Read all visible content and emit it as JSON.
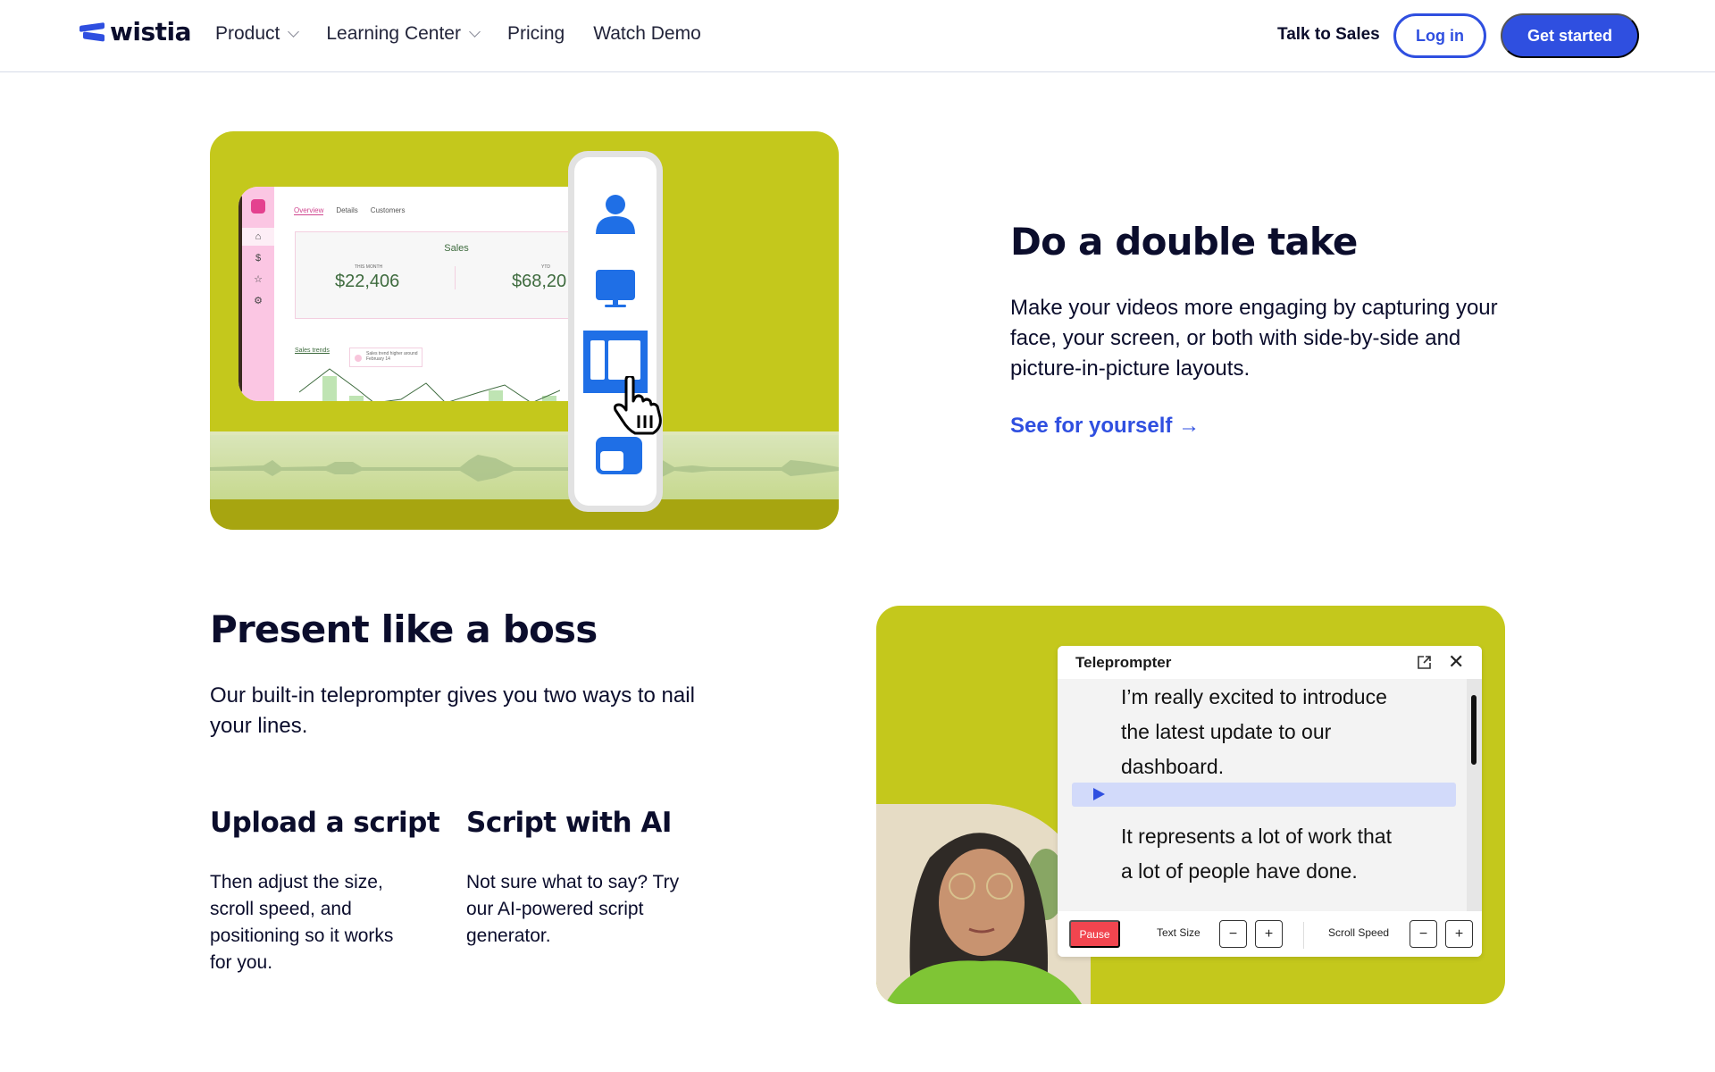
{
  "header": {
    "logo_text": "wistia",
    "nav": [
      {
        "label": "Product",
        "has_dropdown": true
      },
      {
        "label": "Learning Center",
        "has_dropdown": true
      },
      {
        "label": "Pricing",
        "has_dropdown": false
      },
      {
        "label": "Watch Demo",
        "has_dropdown": false
      }
    ],
    "talk_to_sales": "Talk to Sales",
    "login": "Log in",
    "get_started": "Get started"
  },
  "colors": {
    "brand_blue": "#2f4fe0",
    "navy": "#0b0d2c",
    "card_green": "#c4c81c",
    "pause_red": "#f1454f",
    "highlight": "#d2dafa"
  },
  "section1": {
    "title": "Do a double take",
    "body": "Make your videos more engaging by capturing your face, your screen, or both with side-by-side and picture-in-picture layouts.",
    "link": "See for yourself",
    "link_icon": "arrow-right-icon",
    "illustration": {
      "dashboard": {
        "tabs": [
          "Overview",
          "Details",
          "Customers"
        ],
        "active_tab": "Overview",
        "sales_title": "Sales",
        "this_month_label": "THIS MONTH",
        "this_month_value": "$22,406",
        "ytd_label": "YTD",
        "ytd_value": "$68,20",
        "trends_label": "Sales trends",
        "trend_note": "Sales trend higher around February 14"
      },
      "layout_options": [
        "camera-only",
        "screen-only",
        "side-by-side",
        "picture-in-picture"
      ],
      "selected_layout": "side-by-side"
    }
  },
  "section2": {
    "title": "Present like a boss",
    "body": "Our built-in teleprompter gives you two ways to nail your lines.",
    "features": [
      {
        "title": "Upload a script",
        "body": "Then adjust the size, scroll speed, and positioning so it works for you."
      },
      {
        "title": "Script with AI",
        "body": "Not sure what to say? Try our AI-powered script generator."
      }
    ],
    "teleprompter": {
      "title": "Teleprompter",
      "lines_before": [
        "I’m really excited to introduce",
        "the latest update to our",
        "dashboard."
      ],
      "lines_after": [
        "It represents a lot of work that",
        "a lot of people have done."
      ],
      "pause": "Pause",
      "text_size_label": "Text Size",
      "scroll_speed_label": "Scroll Speed",
      "minus": "−",
      "plus": "+"
    }
  }
}
